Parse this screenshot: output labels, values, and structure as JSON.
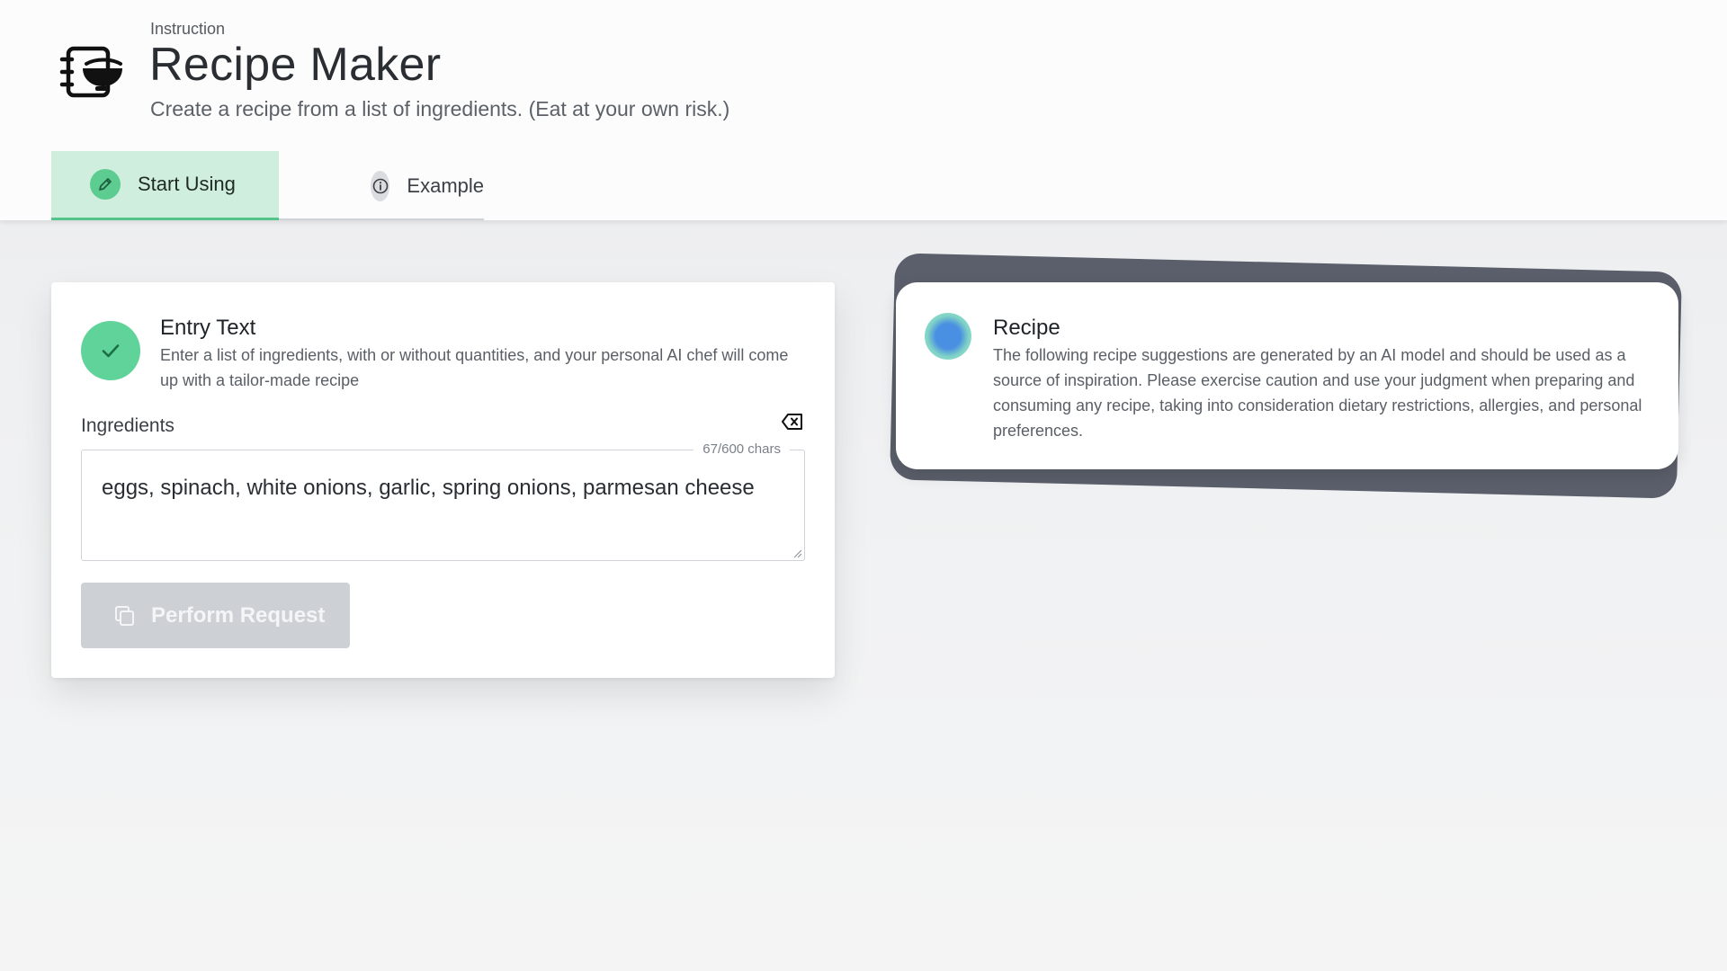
{
  "header": {
    "breadcrumb": "Instruction",
    "title": "Recipe Maker",
    "subtitle": "Create a recipe from a list of ingredients. (Eat at your own risk.)",
    "app_icon": "recipe-bowl-icon"
  },
  "tabs": [
    {
      "label": "Start Using",
      "icon": "pencil-icon",
      "active": true
    },
    {
      "label": "Example",
      "icon": "info-icon",
      "active": false
    }
  ],
  "entry": {
    "title": "Entry Text",
    "description": "Enter a list of ingredients, with or without quantities, and your personal AI chef will come up with a tailor-made recipe",
    "field_label": "Ingredients",
    "char_count": "67/600 chars",
    "value": "eggs, spinach, white onions, garlic, spring onions, parmesan cheese",
    "button_label": "Perform Request"
  },
  "recipe": {
    "title": "Recipe",
    "description": "The following recipe suggestions are generated by an AI model and should be used as a source of inspiration. Please exercise caution and use your judgment when preparing and consuming any recipe, taking into consideration dietary restrictions, allergies, and personal preferences."
  },
  "colors": {
    "accent_green": "#5ccc90",
    "tab_active_bg": "#cfeedd",
    "button_disabled": "#cdd0d4",
    "recipe_backdrop": "#5a5f6b",
    "status_blue": "#4a90e2"
  }
}
